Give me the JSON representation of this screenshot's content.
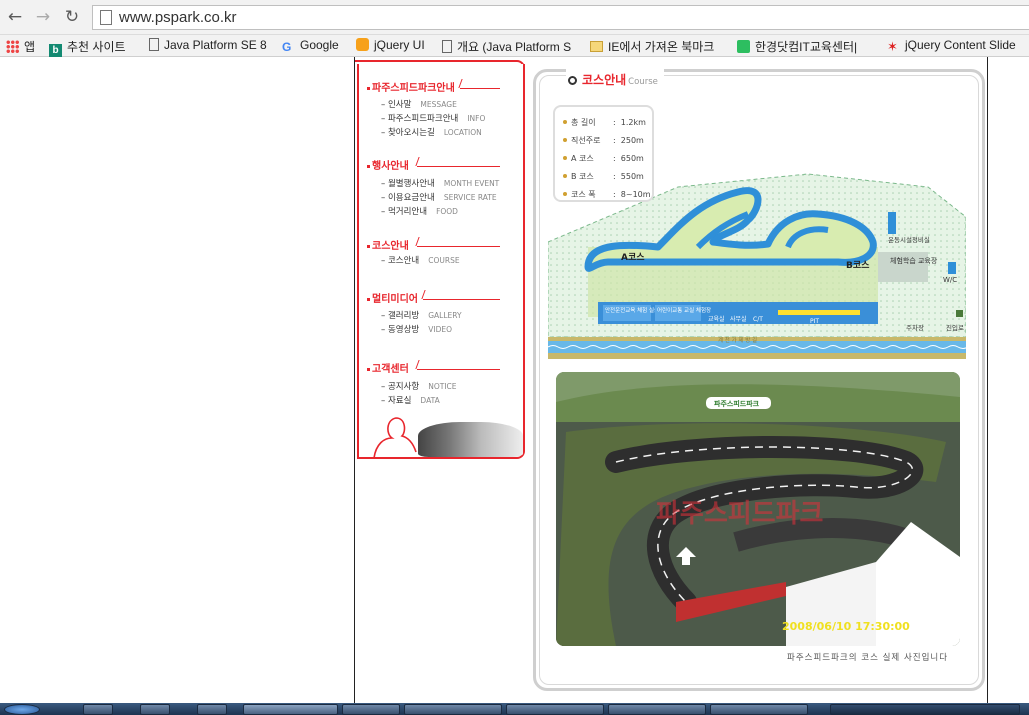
{
  "browser": {
    "url": "www.pspark.co.kr",
    "bookmarks": [
      {
        "label": "앱",
        "icon": "apps-grid-icon"
      },
      {
        "label": "추천 사이트",
        "icon": "bing-icon"
      },
      {
        "label": "Java Platform SE 8",
        "icon": "page-icon"
      },
      {
        "label": "Google",
        "icon": "google-icon"
      },
      {
        "label": "jQuery UI",
        "icon": "jquery-icon"
      },
      {
        "label": "개요 (Java Platform S",
        "icon": "page-icon"
      },
      {
        "label": "IE에서 가져온 북마크",
        "icon": "folder-icon"
      },
      {
        "label": "한경닷컴IT교육센터|",
        "icon": "evernote-icon"
      },
      {
        "label": "jQuery Content Slide",
        "icon": "star-icon"
      }
    ]
  },
  "menu": {
    "sections": [
      {
        "title": "파주스피드파크안내",
        "items": [
          {
            "ko": "인사말",
            "en": "MESSAGE"
          },
          {
            "ko": "파주스피드파크안내",
            "en": "INFO"
          },
          {
            "ko": "찾아오시는길",
            "en": "LOCATION"
          }
        ]
      },
      {
        "title": "행사안내",
        "items": [
          {
            "ko": "월별행사안내",
            "en": "MONTH EVENT"
          },
          {
            "ko": "이용요금안내",
            "en": "SERVICE RATE"
          },
          {
            "ko": "먹거리안내",
            "en": "FOOD"
          }
        ]
      },
      {
        "title": "코스안내",
        "items": [
          {
            "ko": "코스안내",
            "en": "COURSE"
          }
        ]
      },
      {
        "title": "멀티미디어",
        "items": [
          {
            "ko": "갤러리방",
            "en": "GALLERY"
          },
          {
            "ko": "동영상방",
            "en": "VIDEO"
          }
        ]
      },
      {
        "title": "고객센터",
        "items": [
          {
            "ko": "공지사항",
            "en": "NOTICE"
          },
          {
            "ko": "자료실",
            "en": "DATA"
          }
        ]
      }
    ]
  },
  "course": {
    "heading_ko": "코스안내",
    "heading_en": "Course",
    "specs": [
      {
        "label": "총 길이",
        "value": "1.2km"
      },
      {
        "label": "직선주로",
        "value": "250m"
      },
      {
        "label": "A 코스",
        "value": "650m"
      },
      {
        "label": "B 코스",
        "value": "550m"
      },
      {
        "label": "코스 폭",
        "value": "8~10m"
      }
    ],
    "map_labels": {
      "a_course": "A코스",
      "b_course": "B코스",
      "sports_facility": "운동시설정비실",
      "wc": "W/C",
      "experience": "체험학습 교육장",
      "safety": "안전운전교육 체험 실습장",
      "kids": "어린이교통 교실 체험장",
      "classroom": "교육실",
      "office": "사무실",
      "ct": "C/T",
      "pit": "PIT",
      "parking": "주차장",
      "entrance": "진입로",
      "stream": "계 천 가 제 방 길"
    },
    "photo_banner": "파주스피드파크",
    "photo_timestamp": "2008/06/10 17:30:00",
    "photo_caption": "파주스피드파크의 코스 실제 사진입니다"
  }
}
